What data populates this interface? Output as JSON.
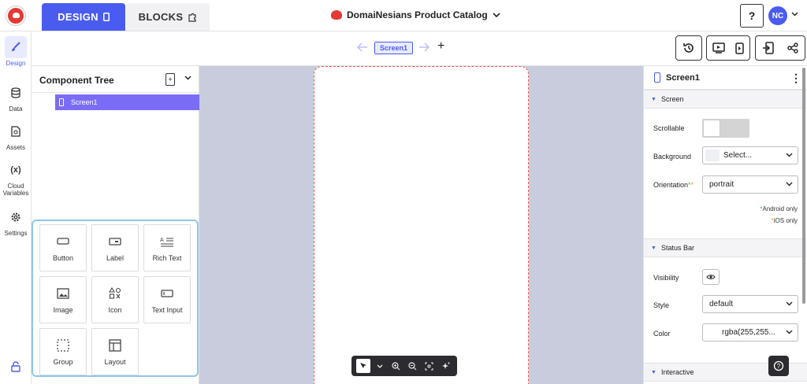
{
  "header": {
    "design_tab": "DESIGN",
    "blocks_tab": "BLOCKS",
    "project_name": "DomaiNesians Product Catalog",
    "help": "?",
    "avatar_initials": "NC"
  },
  "rail": {
    "items": [
      {
        "label": "Design"
      },
      {
        "label": "Data"
      },
      {
        "label": "Assets"
      },
      {
        "label": "Cloud Variables",
        "glyph": "(x)"
      },
      {
        "label": "Settings"
      }
    ]
  },
  "toolbar": {
    "current_screen": "Screen1",
    "add": "+"
  },
  "tree": {
    "title": "Component Tree",
    "screen": "Screen1",
    "palette": [
      {
        "label": "Button"
      },
      {
        "label": "Label"
      },
      {
        "label": "Rich Text"
      },
      {
        "label": "Image"
      },
      {
        "label": "Icon"
      },
      {
        "label": "Text Input"
      },
      {
        "label": "Group"
      },
      {
        "label": "Layout"
      }
    ]
  },
  "props": {
    "title": "Screen1",
    "sections": {
      "screen": "Screen",
      "status_bar": "Status Bar",
      "interactive": "Interactive"
    },
    "scrollable_label": "Scrollable",
    "scrollable_on": false,
    "background_label": "Background",
    "background_value": "Select...",
    "orientation_label": "Orientation",
    "orientation_value": "portrait",
    "android_only": "Android only",
    "ios_only": "iOS only",
    "visibility_label": "Visibility",
    "style_label": "Style",
    "style_value": "default",
    "color_label": "Color",
    "color_value": "rgba(255,255..."
  },
  "colors": {
    "accent": "#4a5cf0",
    "tree_selected": "#7b6cf6",
    "canvas_bg": "#c8ccdc"
  }
}
